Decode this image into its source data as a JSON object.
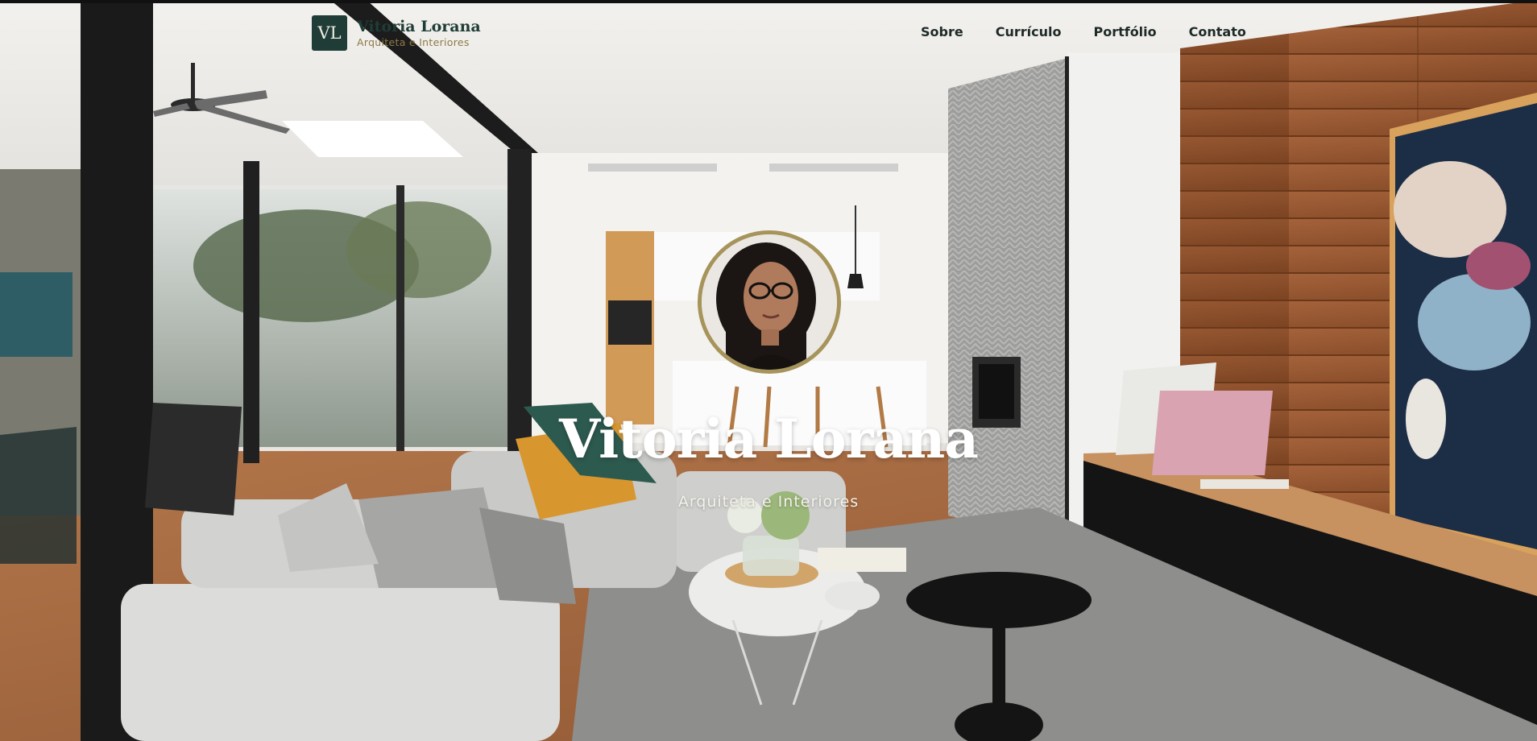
{
  "header": {
    "logo_initials": "VL",
    "brand_name": "Vitoria Lorana",
    "brand_tagline": "Arquiteta e Interiores"
  },
  "nav": {
    "items": [
      {
        "label": "Sobre"
      },
      {
        "label": "Currículo"
      },
      {
        "label": "Portfólio"
      },
      {
        "label": "Contato"
      }
    ]
  },
  "hero": {
    "title": "Vitoria Lorana",
    "subtitle": "Arquiteta e Interiores"
  },
  "colors": {
    "brand_green": "#1f3d36",
    "gold": "#a6945a",
    "wood": "#9a5a2e"
  },
  "icons": {
    "logo": "vl-monogram-icon",
    "portrait": "portrait-photo"
  }
}
